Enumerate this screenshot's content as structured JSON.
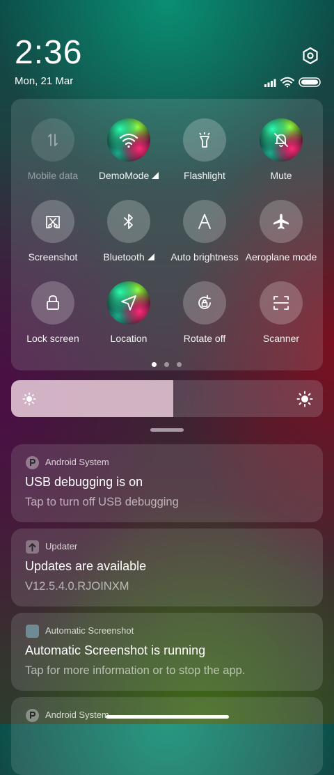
{
  "status": {
    "time": "2:36",
    "date": "Mon, 21 Mar",
    "settings_icon": "gear-hexagon-icon",
    "signal_icon": "cellular-signal-icon",
    "wifi_icon": "wifi-icon",
    "battery_icon": "battery-icon"
  },
  "quick_settings": {
    "tiles": [
      {
        "label": "Mobile data",
        "icon": "mobile-data-icon",
        "state": "disabled"
      },
      {
        "label": "DemoMode",
        "icon": "wifi-icon",
        "state": "active",
        "expandable": true
      },
      {
        "label": "Flashlight",
        "icon": "flashlight-icon",
        "state": "off"
      },
      {
        "label": "Mute",
        "icon": "mute-bell-icon",
        "state": "active"
      },
      {
        "label": "Screenshot",
        "icon": "screenshot-scissors-icon",
        "state": "off"
      },
      {
        "label": "Bluetooth",
        "icon": "bluetooth-icon",
        "state": "off",
        "expandable": true
      },
      {
        "label": "Auto brightness",
        "icon": "auto-brightness-icon",
        "state": "off"
      },
      {
        "label": "Aeroplane mode",
        "icon": "aeroplane-icon",
        "state": "off"
      },
      {
        "label": "Lock screen",
        "icon": "lock-icon",
        "state": "off"
      },
      {
        "label": "Location",
        "icon": "location-arrow-icon",
        "state": "active"
      },
      {
        "label": "Rotate off",
        "icon": "rotate-lock-icon",
        "state": "off"
      },
      {
        "label": "Scanner",
        "icon": "scanner-icon",
        "state": "off"
      }
    ],
    "page_count": 3,
    "current_page": 1
  },
  "brightness": {
    "level": 0.52,
    "min_icon": "sun-small-icon",
    "max_icon": "sun-large-icon"
  },
  "notifications": [
    {
      "app": "Android System",
      "app_icon": "android-system-icon",
      "title": "USB debugging is on",
      "text": "Tap to turn off USB debugging"
    },
    {
      "app": "Updater",
      "app_icon": "updater-icon",
      "title": "Updates are available",
      "text": "V12.5.4.0.RJOINXM"
    },
    {
      "app": "Automatic Screenshot",
      "app_icon": "app-square-icon",
      "title": "Automatic Screenshot is running",
      "text": "Tap for more information or to stop the app."
    },
    {
      "app": "Android System",
      "app_icon": "android-system-icon",
      "title": "",
      "text": ""
    }
  ]
}
